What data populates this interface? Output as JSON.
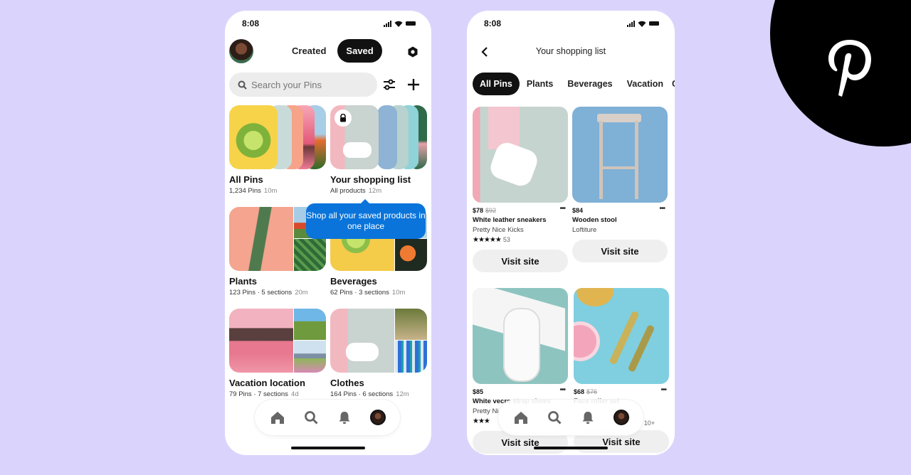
{
  "brand": {
    "name": "Pinterest",
    "icon": "pinterest-p-logo",
    "badge_color": "#000000",
    "background_color": "#DAD4FD"
  },
  "left_phone": {
    "status": {
      "time": "8:08"
    },
    "header": {
      "tabs": [
        {
          "label": "Created",
          "active": false
        },
        {
          "label": "Saved",
          "active": true
        }
      ],
      "settings_icon": "gear-icon"
    },
    "search": {
      "placeholder": "Search your Pins",
      "value": ""
    },
    "boards": [
      {
        "title": "All Pins",
        "meta": "1,234 Pins",
        "age": "10m"
      },
      {
        "title": "Your shopping list",
        "meta": "All products",
        "age": "12m",
        "locked": true
      },
      {
        "title": "Plants",
        "meta": "123 Pins · 5 sections",
        "age": "20m"
      },
      {
        "title": "Beverages",
        "meta": "62 Pins · 3 sections",
        "age": "10m"
      },
      {
        "title": "Vacation location",
        "meta": "79 Pins · 7 sections",
        "age": "4d"
      },
      {
        "title": "Clothes",
        "meta": "164 Pins · 6 sections",
        "age": "12m"
      }
    ],
    "tooltip": {
      "text": "Shop all your saved products in one place",
      "color": "#0A74DA"
    },
    "nav": [
      "home-icon",
      "search-icon",
      "bell-icon",
      "profile-avatar"
    ]
  },
  "right_phone": {
    "status": {
      "time": "8:08"
    },
    "title": "Your shopping list",
    "chips": [
      {
        "label": "All Pins",
        "active": true
      },
      {
        "label": "Plants",
        "active": false
      },
      {
        "label": "Beverages",
        "active": false
      },
      {
        "label": "Vacation",
        "active": false
      },
      {
        "label": "C",
        "active": false
      }
    ],
    "pins": [
      {
        "price": "$78",
        "old_price": "$92",
        "name": "White leather sneakers",
        "brand": "Pretty Nice Kicks",
        "rating": "★★★★★",
        "rating_count": "53",
        "cta": "Visit site"
      },
      {
        "price": "$84",
        "old_price": "",
        "name": "Wooden stool",
        "brand": "Loftiture",
        "rating": "",
        "rating_count": "",
        "cta": "Visit site"
      },
      {
        "price": "$85",
        "old_price": "",
        "name": "White vecro strap shoes",
        "brand": "Pretty Ni",
        "rating": "★★★",
        "rating_count": "",
        "cta": "Visit site"
      },
      {
        "price": "$68",
        "old_price": "$76",
        "name": "Face roller set",
        "brand": "",
        "rating": "",
        "rating_count": "10+",
        "cta": "Visit site"
      }
    ],
    "more_label": "•••",
    "nav": [
      "home-icon",
      "search-icon",
      "bell-icon",
      "profile-avatar"
    ]
  }
}
